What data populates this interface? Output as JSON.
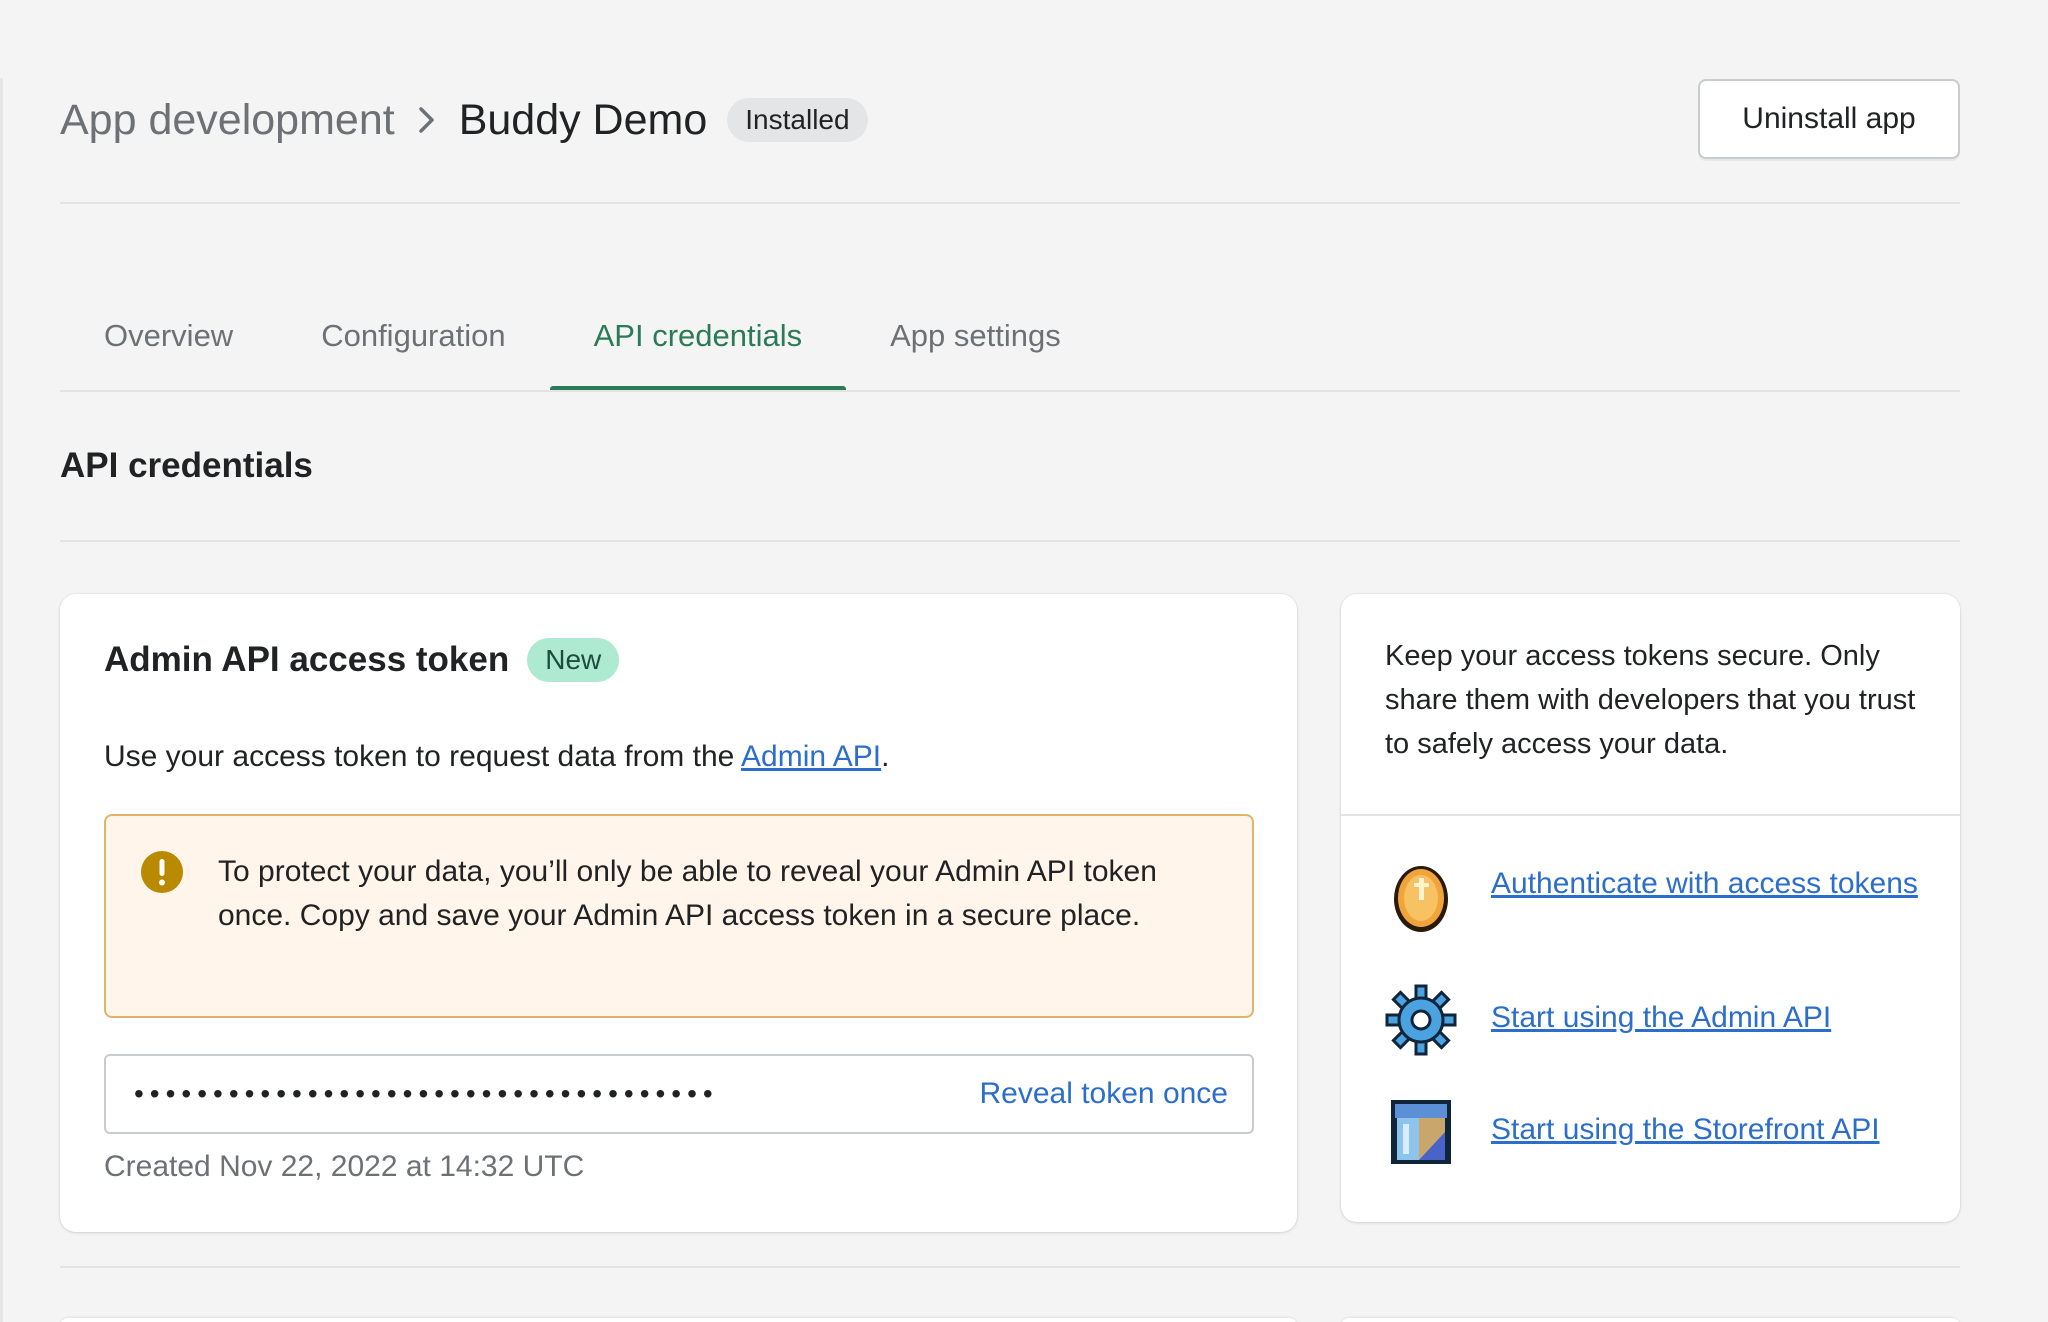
{
  "header": {
    "breadcrumb_parent": "App development",
    "title": "Buddy Demo",
    "status_badge": "Installed",
    "uninstall_label": "Uninstall app"
  },
  "tabs": [
    {
      "label": "Overview",
      "active": false
    },
    {
      "label": "Configuration",
      "active": false
    },
    {
      "label": "API credentials",
      "active": true
    },
    {
      "label": "App settings",
      "active": false
    }
  ],
  "section_title": "API credentials",
  "token_card": {
    "title": "Admin API access token",
    "badge": "New",
    "description_prefix": "Use your access token to request data from the ",
    "description_link": "Admin API",
    "description_suffix": ".",
    "warning": "To protect your data, you’ll only be able to reveal your Admin API token once. Copy and save your Admin API access token in a secure place.",
    "token_masked": "•••••••••••••••••••••••••••••••••••••",
    "reveal_label": "Reveal token once",
    "created": "Created Nov 22, 2022 at 14:32 UTC"
  },
  "help_card": {
    "intro": "Keep your access tokens secure. Only share them with developers that you trust to safely access your data.",
    "resources": [
      {
        "label": "Authenticate with access tokens",
        "icon": "coin-icon"
      },
      {
        "label": "Start using the Admin API",
        "icon": "gear-icon"
      },
      {
        "label": "Start using the Storefront API",
        "icon": "storefront-icon"
      }
    ]
  },
  "colors": {
    "accent": "#2b7a58",
    "link": "#2c6ecb",
    "warning_bg": "#fff5ea",
    "warning_border": "#dfb56a",
    "new_badge": "#aee9d1"
  }
}
